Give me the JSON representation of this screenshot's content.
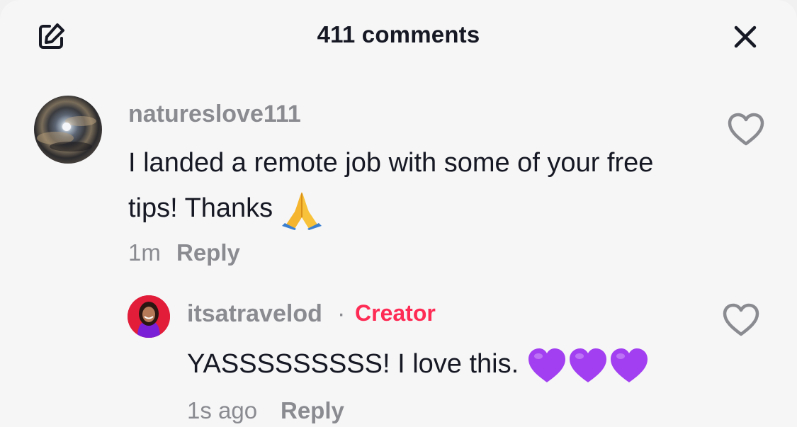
{
  "header": {
    "title": "411 comments",
    "edit_icon": "edit-icon",
    "close_icon": "close-icon"
  },
  "comments": [
    {
      "username": "natureslove111",
      "text": "I landed a remote job with some of your free tips! Thanks",
      "emoji": "folded-hands",
      "time": "1m",
      "reply_label": "Reply",
      "like_icon": "heart-outline-icon"
    },
    {
      "username": "itsatravelod",
      "separator": "·",
      "badge": "Creator",
      "text": "YASSSSSSSSS! I love this.",
      "emoji": "purple-heart x3",
      "time": "1s ago",
      "reply_label": "Reply",
      "like_icon": "heart-outline-icon"
    }
  ],
  "colors": {
    "background": "#f6f6f7",
    "text_primary": "#161823",
    "text_secondary": "#8a8b91",
    "creator_badge": "#fe2c55",
    "purple_heart": "#a23ff0"
  }
}
